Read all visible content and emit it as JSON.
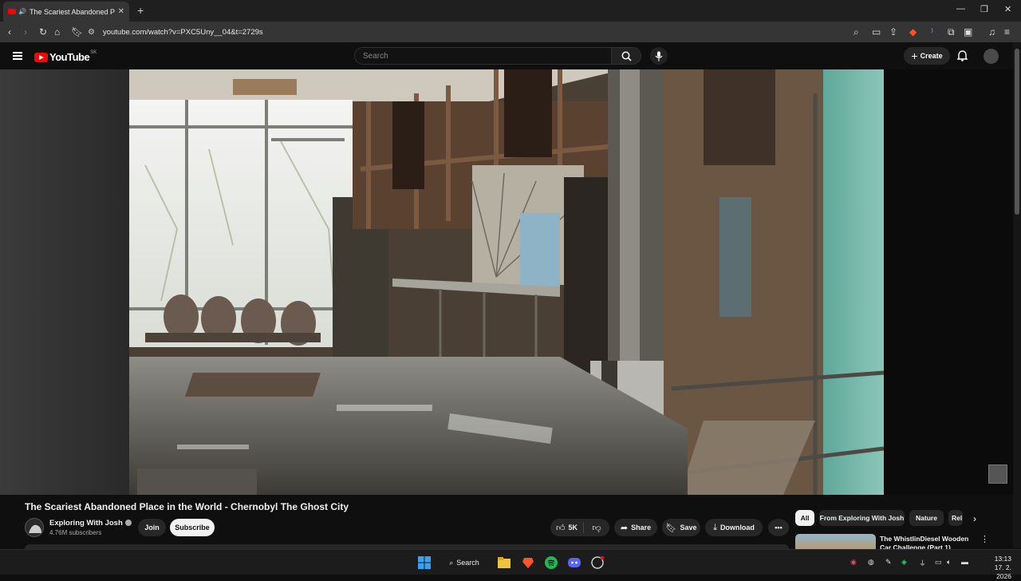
{
  "browser": {
    "tab_title": "The Scariest Abandoned Place",
    "url": "youtube.com/watch?v=PXC5Uny__04&t=2729s",
    "window_controls": {
      "minimize": "—",
      "restore": "❐",
      "close": "✕"
    }
  },
  "youtube": {
    "logo_text": "YouTube",
    "country_code": "SK",
    "search_placeholder": "Search",
    "create_label": "Create"
  },
  "video": {
    "title": "The Scariest Abandoned Place in the World - Chernobyl The Ghost City",
    "channel": "Exploring With Josh",
    "subscribers": "4.76M subscribers",
    "join_label": "Join",
    "subscribe_label": "Subscribe",
    "likes": "5K",
    "share_label": "Share",
    "save_label": "Save",
    "download_label": "Download"
  },
  "sidebar": {
    "chips": [
      "All",
      "From Exploring With Josh",
      "Nature",
      "Rel"
    ],
    "recommendation_title": "The WhistlinDiesel Wooden Car Challenge (Part 1)"
  },
  "taskbar": {
    "search_label": "Search",
    "time": "13:13",
    "date": "17. 2. 2026"
  },
  "colors": {
    "youtube_red": "#ff0000",
    "background": "#0f0f0f",
    "pill": "#272727"
  }
}
